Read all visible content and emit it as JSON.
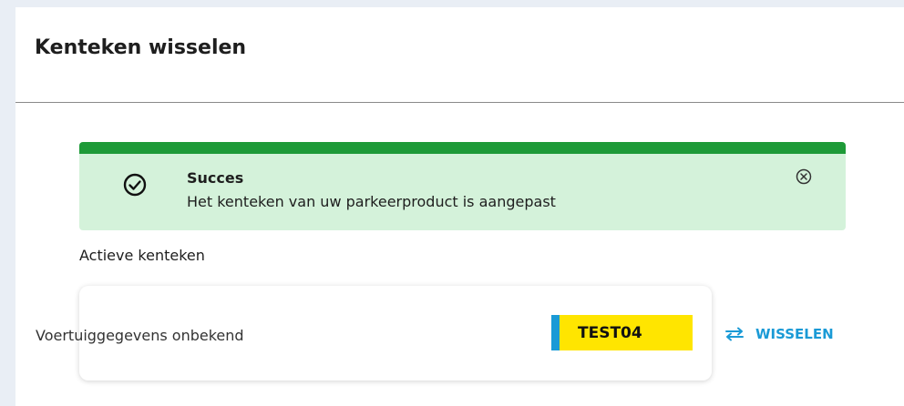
{
  "page": {
    "title": "Kenteken wisselen"
  },
  "alert": {
    "title": "Succes",
    "message": "Het kenteken van uw parkeerproduct is aangepast",
    "icon": "check-circle-icon",
    "close_icon": "close-circle-icon",
    "colors": {
      "bar": "#1e9a38",
      "background": "#d4f2da"
    }
  },
  "active_plates": {
    "label": "Actieve kenteken",
    "vehicle_info": "Voertuiggegevens onbekend",
    "plate": "TEST04",
    "swap_label": "WISSELEN",
    "swap_icon": "swap-arrows-icon",
    "colors": {
      "plate": "#ffe500",
      "plate_band": "#1a9ad6",
      "accent": "#1a9ad6"
    }
  }
}
